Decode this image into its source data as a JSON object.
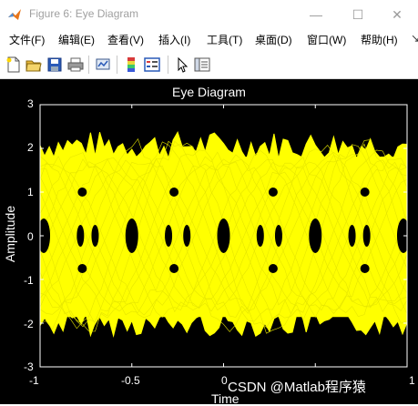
{
  "window": {
    "title": "Figure 6: Eye Diagram",
    "controls": {
      "minimize": "—",
      "maximize": "☐",
      "close": "✕"
    }
  },
  "menu": {
    "items": [
      "文件(F)",
      "编辑(E)",
      "查看(V)",
      "插入(I)",
      "工具(T)",
      "桌面(D)",
      "窗口(W)",
      "帮助(H)"
    ],
    "overflow": "↘"
  },
  "toolbar": {
    "icons": [
      "new-figure-icon",
      "open-file-icon",
      "save-icon",
      "print-icon",
      "link-plot-icon",
      "insert-colorbar-icon",
      "insert-legend-icon",
      "pointer-icon",
      "property-editor-icon"
    ]
  },
  "colors": {
    "trace": "#ffff00",
    "background": "#000000",
    "axis": "#ffffff"
  },
  "chart_data": {
    "type": "line",
    "title": "Eye Diagram",
    "xlabel": "Time",
    "ylabel": "Amplitude",
    "xlim": [
      -1,
      1
    ],
    "ylim": [
      -3,
      3
    ],
    "xticks": [
      "-1",
      "-0.5",
      "0",
      "0.5",
      "1"
    ],
    "yticks": [
      "3",
      "2",
      "1",
      "0",
      "-1",
      "-2",
      "-3"
    ],
    "grid": false,
    "series_color": "#ffff00",
    "levels": [
      -2,
      -1,
      0,
      1,
      2
    ],
    "eye_centers": [
      -0.98,
      -0.5,
      0.0,
      0.5,
      0.98
    ],
    "overlay_envelope": {
      "upper_peak": 2.4,
      "lower_peak": -2.3
    }
  },
  "watermark": "CSDN @Matlab程序猿"
}
